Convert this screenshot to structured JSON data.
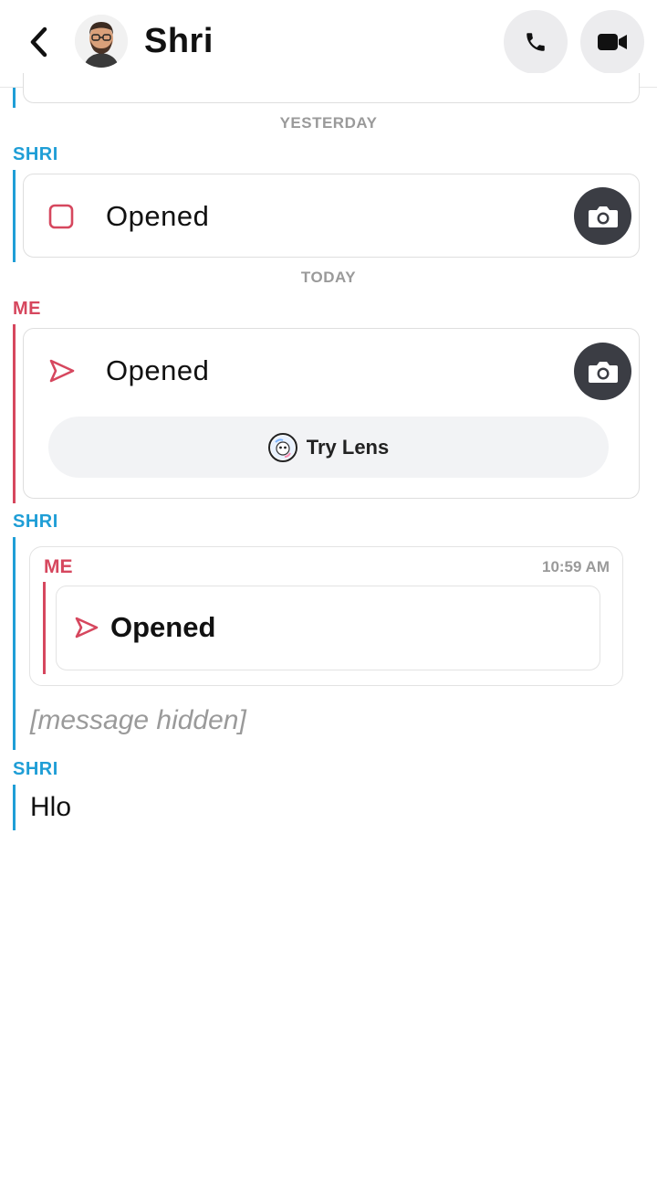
{
  "header": {
    "title": "Shri",
    "back_icon": "chevron-left-icon",
    "call_icon": "phone-icon",
    "video_icon": "video-camera-icon"
  },
  "thread": {
    "date_yesterday": "YESTERDAY",
    "date_today": "TODAY",
    "sender_shri_1": "SHRI",
    "snap_shri_status": "Opened",
    "sender_me": "ME",
    "snap_me_status": "Opened",
    "try_lens_label": "Try Lens",
    "sender_shri_2": "SHRI",
    "reply_quote": {
      "sender": "ME",
      "time": "10:59 AM",
      "status": "Opened"
    },
    "reply_message": "[message hidden]",
    "sender_shri_3": "SHRI",
    "last_message": "Hlo"
  },
  "colors": {
    "friend_accent": "#1f9ed6",
    "me_accent": "#d6475e",
    "camera_button": "#3b3d44",
    "header_button": "#ececee"
  }
}
